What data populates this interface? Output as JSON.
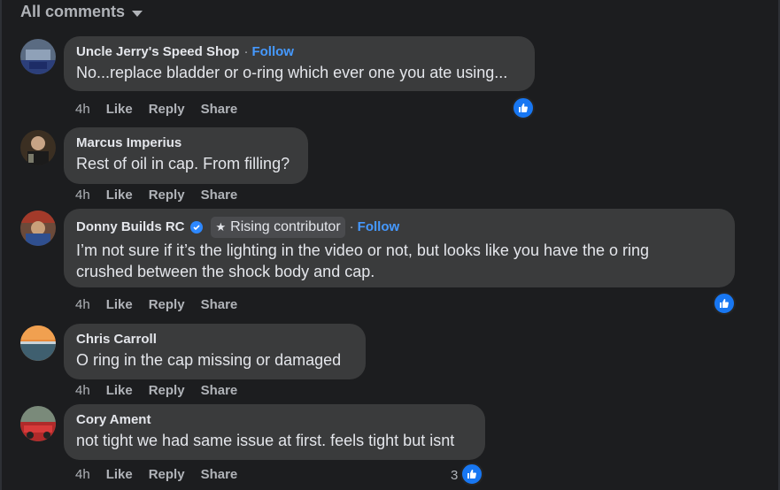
{
  "header": {
    "filter_label": "All comments"
  },
  "follow_label": "Follow",
  "actions": {
    "like": "Like",
    "reply": "Reply",
    "share": "Share"
  },
  "comments": [
    {
      "author": "Uncle Jerry's Speed Shop",
      "text": "No...replace bladder or o-ring which ever one you ate using...",
      "time": "4h",
      "reactions": ""
    },
    {
      "author": "Marcus Imperius",
      "text": "Rest of oil in cap. From filling?",
      "time": "4h",
      "reactions": ""
    },
    {
      "author": "Donny Builds RC",
      "badge": "Rising contributor",
      "text_line1": "I’m not sure if it’s the lighting in the video or not, but looks like you have the o ring",
      "text_line2": "crushed between the shock body and cap.",
      "time": "4h",
      "reactions": ""
    },
    {
      "author": "Chris Carroll",
      "text": "O ring in the cap missing or damaged",
      "time": "4h",
      "reactions": ""
    },
    {
      "author": "Cory Ament",
      "text": "not tight we had same issue at first. feels tight but isnt",
      "time": "4h",
      "reactions": "3"
    }
  ],
  "icons": {
    "like_reaction": "thumbs-up-icon",
    "verified": "verified-badge-icon",
    "rising": "star-icon",
    "filter_caret": "caret-down-icon"
  },
  "colors": {
    "background": "#1c1d1f",
    "bubble": "#3a3b3c",
    "link": "#4599ff",
    "like_blue": "#1877f2"
  }
}
